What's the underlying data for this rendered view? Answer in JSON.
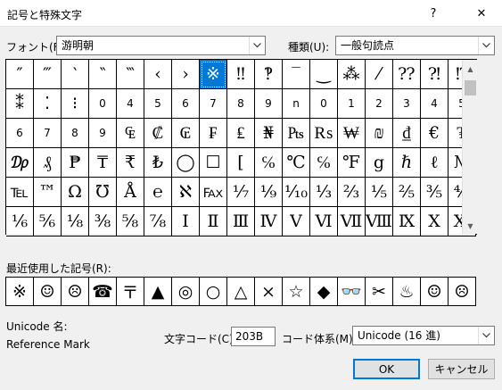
{
  "window": {
    "title": "記号と特殊文字",
    "help": "?",
    "close": "✕"
  },
  "font": {
    "label": "フォント(F):",
    "value": "游明朝"
  },
  "category": {
    "label": "種類(U):",
    "value": "一般句読点"
  },
  "grid": [
    "″",
    "‴",
    "‵",
    "‶",
    "‷",
    "‹",
    "›",
    "※",
    "‼",
    "‽",
    "‾",
    "‿",
    "⁂",
    "⁄",
    "⁇",
    "⁈",
    "⁉",
    "⁑",
    "⁚",
    "⁝",
    "0",
    "4",
    "5",
    "6",
    "7",
    "8",
    "9",
    "n",
    "0",
    "1",
    "2",
    "3",
    "4",
    "5",
    "6",
    "7",
    "8",
    "9",
    "₠",
    "₡",
    "₢",
    "₣",
    "₤",
    "₦",
    "₧",
    "₨",
    "₩",
    "₪",
    "₫",
    "€",
    "₮",
    "₯",
    "₰",
    "₱",
    "₸",
    "₹",
    "₺",
    "◯",
    "☐",
    "[",
    "℅",
    "℃",
    "℅",
    "℉",
    "g",
    "ℏ",
    "ℓ",
    "№",
    "℡",
    "™",
    "Ω",
    "℧",
    "Å",
    "℮",
    "ℵ",
    "℻",
    "⅐",
    "⅑",
    "⅒",
    "⅓",
    "⅔",
    "⅕",
    "⅖",
    "⅗",
    "⅘",
    "⅙",
    "⅚",
    "⅛",
    "⅜",
    "⅝",
    "⅞",
    "Ⅰ",
    "Ⅱ",
    "Ⅲ",
    "Ⅳ",
    "Ⅴ",
    "Ⅵ",
    "Ⅶ",
    "Ⅷ",
    "Ⅸ",
    "Ⅹ",
    "Ⅺ"
  ],
  "selected_index": 7,
  "recent": {
    "label": "最近使用した記号(R):",
    "symbols": [
      "※",
      "☺",
      "☹",
      "☎",
      "〒",
      "▲",
      "◎",
      "○",
      "△",
      "×",
      "☆",
      "◆",
      "👓",
      "✂",
      "♨",
      "☺",
      "☹"
    ]
  },
  "unicode_name": {
    "label": "Unicode 名:",
    "value": "Reference Mark"
  },
  "char_code": {
    "label": "文字コード(C):",
    "value": "203B"
  },
  "code_system": {
    "label": "コード体系(M):",
    "value": "Unicode (16 進)"
  },
  "buttons": {
    "ok": "OK",
    "cancel": "キャンセル"
  }
}
